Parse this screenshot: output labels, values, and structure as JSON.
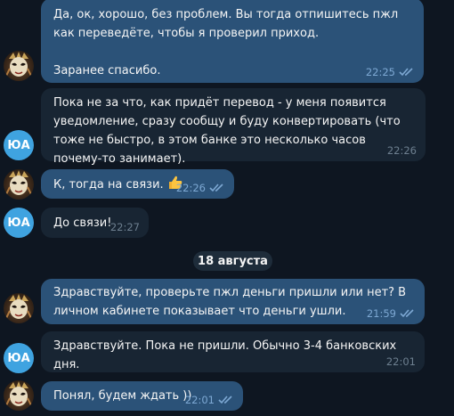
{
  "messages": [
    {
      "text": "Да, ок, хорошо, без проблем. Вы тогда отпишитесь пжл как переведёте, чтобы я проверил приход.\n\nЗаранее спасибо.",
      "time": "22:25"
    },
    {
      "initials": "ЮА",
      "text": "Пока не за что, как придёт перевод - у меня появится уведомление, сразу сообщу и буду конвертировать (что тоже не быстро, в этом банке это несколько часов почему-то занимает).",
      "time": "22:26"
    },
    {
      "text": "К, тогда на связи.",
      "emoji": "thumbs-up",
      "time": "22:26"
    },
    {
      "initials": "ЮА",
      "text": "До связи!",
      "time": "22:27"
    },
    {
      "text": "Здравствуйте, проверьте пжл деньги пришли или нет? В личном кабинете показывает что деньги ушли.",
      "time": "21:59"
    },
    {
      "initials": "ЮА",
      "text": "Здравствуйте. Пока не пришли. Обычно 3-4 банковских дня.",
      "time": "22:01"
    },
    {
      "text": "Понял, будем ждать ))",
      "time": "22:01"
    }
  ],
  "date_separator": "18 августа",
  "colors": {
    "background": "#0e1621",
    "outgoing_bubble": "#2b5278",
    "incoming_bubble": "#182533",
    "avatar": "#3fa3e0"
  },
  "icons": {
    "read_receipt": "double-check-icon",
    "avatar_mask": "carnival-mask-icon"
  }
}
